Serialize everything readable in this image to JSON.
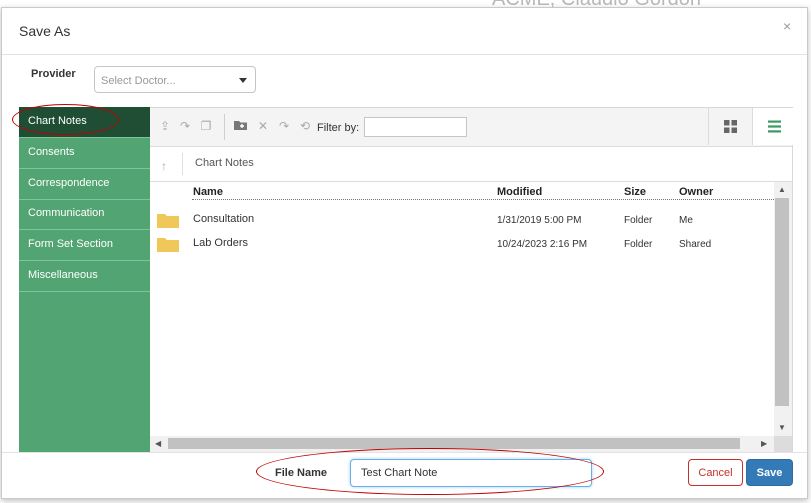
{
  "background": {
    "header_text": "ACME, Claudio Gordon"
  },
  "dialog": {
    "title": "Save As",
    "close_glyph": "×",
    "provider": {
      "label": "Provider",
      "placeholder": "Select Doctor..."
    },
    "sidebar": {
      "items": [
        {
          "label": "Chart Notes",
          "active": true
        },
        {
          "label": "Consents"
        },
        {
          "label": "Correspondence"
        },
        {
          "label": "Communication"
        },
        {
          "label": "Form Set Section"
        },
        {
          "label": "Miscellaneous"
        }
      ]
    },
    "toolbar": {
      "icons": [
        "upload-icon",
        "redo-icon",
        "copy-icon",
        "new-folder-icon",
        "delete-icon",
        "forward-icon",
        "refresh-icon"
      ],
      "filter_label": "Filter by:",
      "filter_value": "",
      "view_icons": [
        "grid-view-icon",
        "list-view-icon"
      ]
    },
    "breadcrumb": {
      "current": "Chart Notes"
    },
    "file_list": {
      "columns": [
        "Name",
        "Modified",
        "Size",
        "Owner"
      ],
      "rows": [
        {
          "name": "Consultation",
          "modified": "1/31/2019 5:00 PM",
          "size": "Folder",
          "owner": "Me"
        },
        {
          "name": "Lab Orders",
          "modified": "10/24/2023 2:16 PM",
          "size": "Folder",
          "owner": "Shared"
        }
      ]
    },
    "footer": {
      "file_name_label": "File Name",
      "file_name_value": "Test Chart Note",
      "cancel_label": "Cancel",
      "save_label": "Save"
    }
  },
  "colors": {
    "sidebar_bg": "#53a473",
    "sidebar_active": "#1f4e35",
    "save_button": "#337ab7",
    "cancel_border": "#c4302b",
    "annotation": "#c00000",
    "folder": "#f0c85a"
  }
}
